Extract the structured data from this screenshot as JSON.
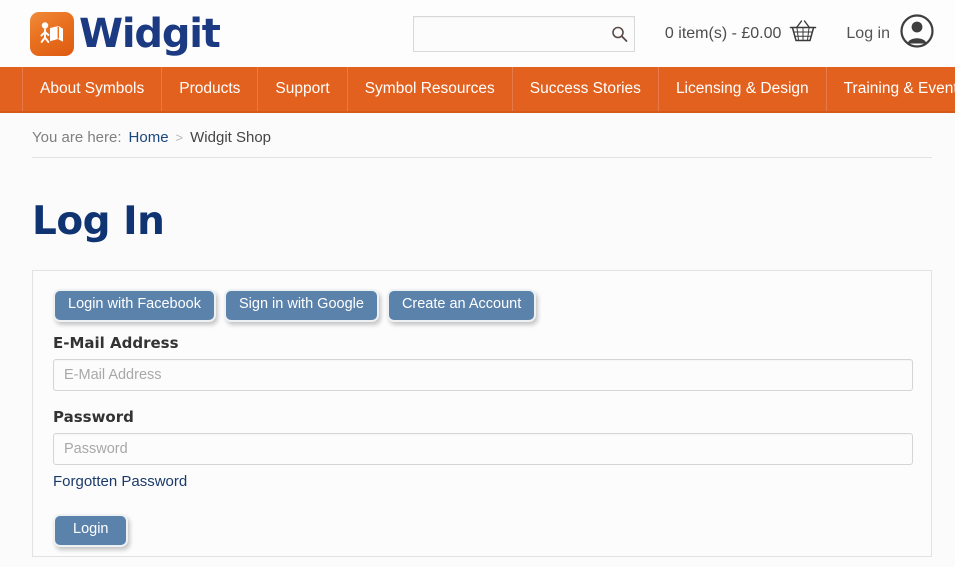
{
  "header": {
    "logo_text": "Widgit",
    "logo_icon": "widgit-symbol-icon",
    "search": {
      "value": "",
      "placeholder": "",
      "icon": "search-icon"
    },
    "cart": {
      "text": "0 item(s) - £0.00",
      "icon": "basket-icon"
    },
    "account": {
      "label": "Log in",
      "icon": "user-avatar-icon"
    }
  },
  "nav": {
    "items": [
      {
        "label": "About Symbols"
      },
      {
        "label": "Products"
      },
      {
        "label": "Support"
      },
      {
        "label": "Symbol Resources"
      },
      {
        "label": "Success Stories"
      },
      {
        "label": "Licensing & Design"
      },
      {
        "label": "Training & Events"
      }
    ]
  },
  "breadcrumb": {
    "prefix": "You are here:",
    "home": "Home",
    "separator": ">",
    "current": "Widgit Shop"
  },
  "page": {
    "title": "Log In"
  },
  "form": {
    "social_buttons": [
      {
        "label": "Login with Facebook"
      },
      {
        "label": "Sign in with Google"
      },
      {
        "label": "Create an Account"
      }
    ],
    "email": {
      "label": "E-Mail Address",
      "placeholder": "E-Mail Address",
      "value": ""
    },
    "password": {
      "label": "Password",
      "placeholder": "Password",
      "value": ""
    },
    "forgotten_password": "Forgotten Password",
    "submit": "Login"
  },
  "colors": {
    "brand_orange": "#e2611e",
    "brand_navy": "#1b3a82",
    "heading_navy": "#0f3471",
    "button_blue": "#5b82ab",
    "link_blue": "#19487f"
  }
}
